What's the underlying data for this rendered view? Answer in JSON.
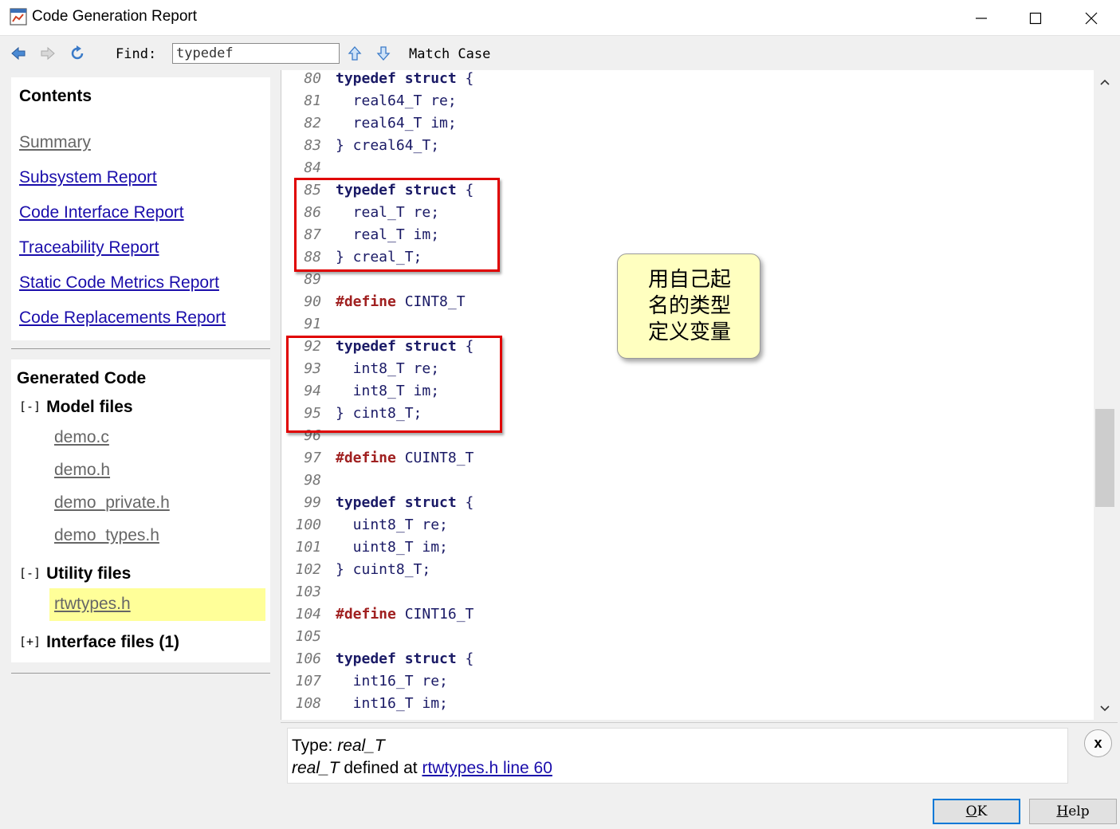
{
  "window": {
    "title": "Code Generation Report"
  },
  "toolbar": {
    "find_label": "Find:",
    "find_value": "typedef",
    "match_case": "Match Case"
  },
  "contents": {
    "title": "Contents",
    "links": [
      {
        "label": "Summary",
        "visited": true
      },
      {
        "label": "Subsystem Report",
        "visited": false
      },
      {
        "label": "Code Interface Report",
        "visited": false
      },
      {
        "label": "Traceability Report",
        "visited": false
      },
      {
        "label": "Static Code Metrics Report",
        "visited": false
      },
      {
        "label": "Code Replacements Report",
        "visited": false
      }
    ]
  },
  "generated": {
    "title": "Generated Code",
    "model_group": {
      "toggle": "[-]",
      "name": "Model files"
    },
    "model_files": [
      "demo.c",
      "demo.h",
      "demo_private.h",
      "demo_types.h"
    ],
    "utility_group": {
      "toggle": "[-]",
      "name": "Utility files"
    },
    "utility_files": [
      "rtwtypes.h"
    ],
    "interface_group": {
      "toggle": "[+]",
      "name": "Interface files (1)"
    }
  },
  "code": {
    "lines": [
      {
        "n": "80",
        "kw": "typedef struct",
        "text": " {"
      },
      {
        "n": "81",
        "kw": "",
        "text": "  real64_T re;"
      },
      {
        "n": "82",
        "kw": "",
        "text": "  real64_T im;"
      },
      {
        "n": "83",
        "kw": "",
        "text": "} creal64_T;"
      },
      {
        "n": "84",
        "kw": "",
        "text": ""
      },
      {
        "n": "85",
        "kw": "typedef struct",
        "text": " {"
      },
      {
        "n": "86",
        "kw": "",
        "text": "  real_T re;"
      },
      {
        "n": "87",
        "kw": "",
        "text": "  real_T im;"
      },
      {
        "n": "88",
        "kw": "",
        "text": "} creal_T;"
      },
      {
        "n": "89",
        "kw": "",
        "text": ""
      },
      {
        "n": "90",
        "def": "#define",
        "text": " CINT8_T"
      },
      {
        "n": "91",
        "kw": "",
        "text": ""
      },
      {
        "n": "92",
        "kw": "typedef struct",
        "text": " {"
      },
      {
        "n": "93",
        "kw": "",
        "text": "  int8_T re;"
      },
      {
        "n": "94",
        "kw": "",
        "text": "  int8_T im;"
      },
      {
        "n": "95",
        "kw": "",
        "text": "} cint8_T;"
      },
      {
        "n": "96",
        "kw": "",
        "text": ""
      },
      {
        "n": "97",
        "def": "#define",
        "text": " CUINT8_T"
      },
      {
        "n": "98",
        "kw": "",
        "text": ""
      },
      {
        "n": "99",
        "kw": "typedef struct",
        "text": " {"
      },
      {
        "n": "100",
        "kw": "",
        "text": "  uint8_T re;"
      },
      {
        "n": "101",
        "kw": "",
        "text": "  uint8_T im;"
      },
      {
        "n": "102",
        "kw": "",
        "text": "} cuint8_T;"
      },
      {
        "n": "103",
        "kw": "",
        "text": ""
      },
      {
        "n": "104",
        "def": "#define",
        "text": " CINT16_T"
      },
      {
        "n": "105",
        "kw": "",
        "text": ""
      },
      {
        "n": "106",
        "kw": "typedef struct",
        "text": " {"
      },
      {
        "n": "107",
        "kw": "",
        "text": "  int16_T re;"
      },
      {
        "n": "108",
        "kw": "",
        "text": "  int16_T im;"
      }
    ]
  },
  "callout": {
    "lines": [
      "用自己起",
      "名的类型",
      "定义变量"
    ]
  },
  "info": {
    "type_label": "Type: ",
    "type_value": "real_T",
    "def_name": "real_T",
    "def_text": " defined at ",
    "def_link": "rtwtypes.h line 60",
    "close": "x"
  },
  "buttons": {
    "ok_u": "O",
    "ok_rest": "K",
    "help_u": "H",
    "help_rest": "elp"
  },
  "colors": {
    "highlight_border": "#e00000",
    "callout_bg": "#ffffc0",
    "selected_file_bg": "#ffff99",
    "link": "#1a0dab"
  }
}
